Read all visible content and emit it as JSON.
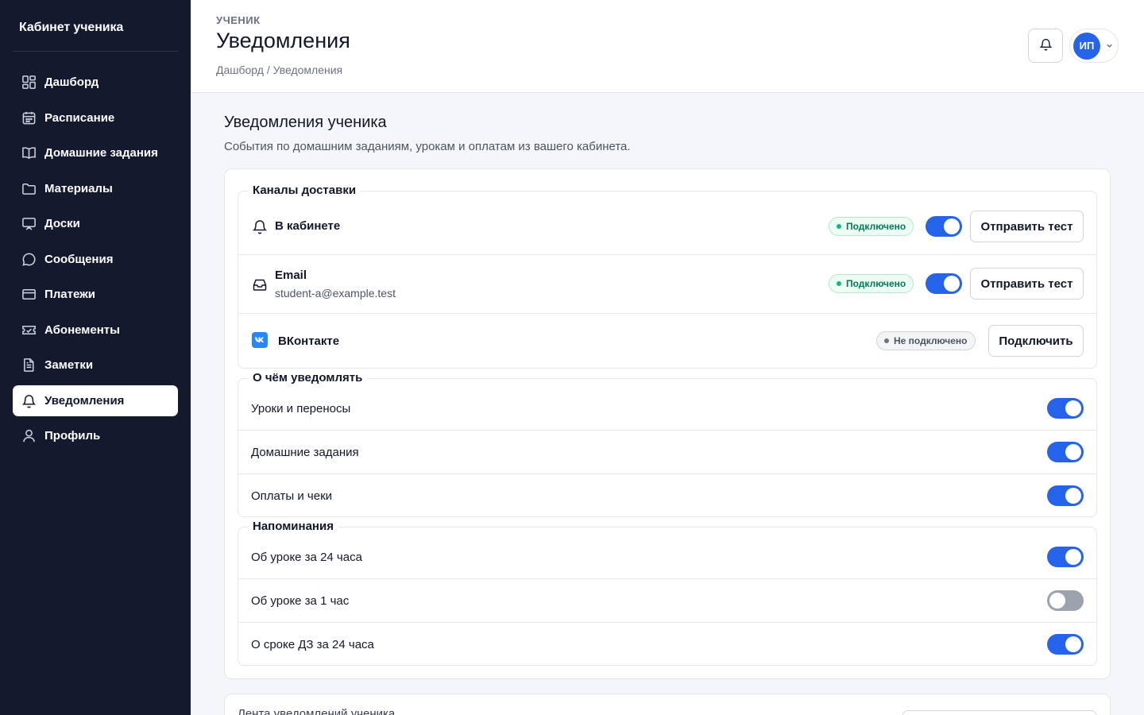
{
  "sidebar": {
    "brand": "Кабинет ученика",
    "items": [
      {
        "label": "Дашборд",
        "icon": "dashboard-icon"
      },
      {
        "label": "Расписание",
        "icon": "calendar-icon"
      },
      {
        "label": "Домашние задания",
        "icon": "book-icon"
      },
      {
        "label": "Материалы",
        "icon": "folder-icon"
      },
      {
        "label": "Доски",
        "icon": "board-icon"
      },
      {
        "label": "Сообщения",
        "icon": "message-icon"
      },
      {
        "label": "Платежи",
        "icon": "card-icon"
      },
      {
        "label": "Абонементы",
        "icon": "ticket-icon"
      },
      {
        "label": "Заметки",
        "icon": "note-icon"
      },
      {
        "label": "Уведомления",
        "icon": "bell-icon",
        "active": true
      },
      {
        "label": "Профиль",
        "icon": "user-icon"
      }
    ]
  },
  "header": {
    "eyebrow": "УЧЕНИК",
    "title": "Уведомления",
    "breadcrumb": "Дашборд / Уведомления",
    "user_initials": "ИП",
    "accent": "#2563eb"
  },
  "main": {
    "title": "Уведомления ученика",
    "subtitle": "События по домашним заданиям, урокам и оплатам из вашего кабинета.",
    "channels": {
      "legend": "Каналы доставки",
      "items": [
        {
          "name": "В кабинете",
          "status": "Подключено",
          "enabled": true,
          "action": "Отправить тест",
          "icon": "bell-icon"
        },
        {
          "name": "Email",
          "detail": "student-a@example.test",
          "status": "Подключено",
          "enabled": true,
          "action": "Отправить тест",
          "icon": "inbox-icon"
        },
        {
          "name": "ВКонтакте",
          "status": "Не подключено",
          "action": "Подключить",
          "icon": "vk-icon"
        }
      ]
    },
    "topics": {
      "legend": "О чём уведомлять",
      "items": [
        {
          "label": "Уроки и переносы",
          "enabled": true
        },
        {
          "label": "Домашние задания",
          "enabled": true
        },
        {
          "label": "Оплаты и чеки",
          "enabled": true
        }
      ]
    },
    "reminders": {
      "legend": "Напоминания",
      "items": [
        {
          "label": "Об уроке за 24 часа",
          "enabled": true
        },
        {
          "label": "Об уроке за 1 час",
          "enabled": false
        },
        {
          "label": "О сроке ДЗ за 24 часа",
          "enabled": true
        }
      ]
    },
    "feed": {
      "title": "Лента уведомлений ученика"
    }
  }
}
